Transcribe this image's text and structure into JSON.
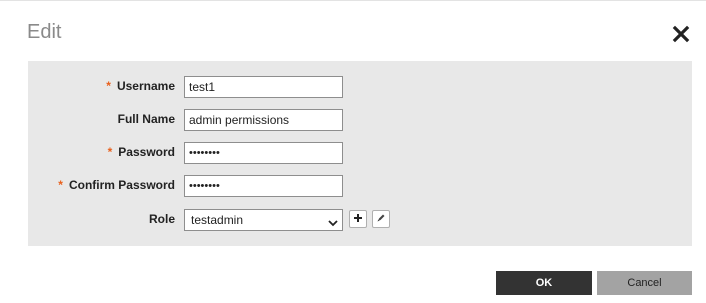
{
  "dialog": {
    "title": "Edit",
    "close_icon": "close-x-icon"
  },
  "form": {
    "required_marker": "*",
    "username": {
      "label": "Username",
      "value": "test1",
      "required": true
    },
    "full_name": {
      "label": "Full Name",
      "value": "admin permissions",
      "required": false
    },
    "password": {
      "label": "Password",
      "value": "••••••••",
      "required": true
    },
    "confirm_password": {
      "label": "Confirm Password",
      "value": "••••••••",
      "required": true
    },
    "role": {
      "label": "Role",
      "selected": "testadmin",
      "add_icon": "plus-icon",
      "edit_icon": "pencil-icon"
    }
  },
  "actions": {
    "ok_label": "OK",
    "cancel_label": "Cancel"
  },
  "colors": {
    "required": "#e8601c",
    "panel_bg": "#e8e8e8",
    "ok_bg": "#333333",
    "cancel_bg": "#a3a3a3",
    "title": "#8a8a8a"
  }
}
